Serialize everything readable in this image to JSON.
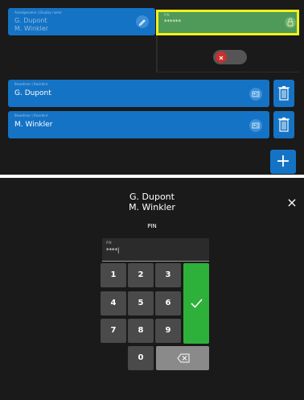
{
  "top": {
    "display_card": {
      "label": "Anzeigename | Display name",
      "line1": "G. Dupont",
      "line2": "M. Winkler"
    },
    "pin_field": {
      "label": "PIN",
      "value": "******"
    },
    "residents": [
      {
        "label": "Bewohner | Resident",
        "name": "G. Dupont"
      },
      {
        "label": "Bewohner | Resident",
        "name": "M. Winkler"
      }
    ],
    "add_label": "+"
  },
  "bottom": {
    "title_line1": "G. Dupont",
    "title_line2": "M. Winkler",
    "subtitle": "PIN",
    "close_label": "×",
    "pin_input": {
      "label": "PIN",
      "value": "****|"
    },
    "keys": [
      "1",
      "2",
      "3",
      "4",
      "5",
      "6",
      "7",
      "8",
      "9",
      "0"
    ]
  },
  "colors": {
    "card": "#1573c5",
    "pin_bg": "#4f9a59",
    "highlight": "#f3f01a",
    "ok": "#2eb13a",
    "panel": "#1a1a1a"
  }
}
